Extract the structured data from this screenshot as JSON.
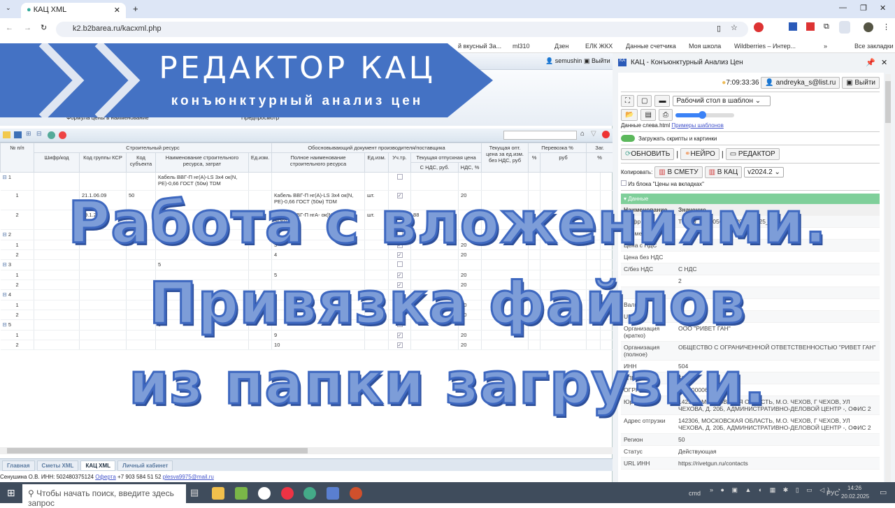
{
  "browser": {
    "tab_title": "КАЦ XML",
    "url": "k2.b2barea.ru/kacxml.php",
    "bookmarks": [
      "й вкусный За...",
      "ml310",
      "Дзен",
      "ЕЛК ЖКХ",
      "Данные счетчика",
      "Моя школа",
      "Wildberries – Интер...",
      "»",
      "Все закладки"
    ]
  },
  "banner": {
    "title": "РЕДАКТОР КАЦ",
    "subtitle": "конъюнктурный анализ цен"
  },
  "overlay": {
    "line1": "Работа с вложениями.",
    "line2": "Привязка файлов",
    "line3": "из папки загрузки."
  },
  "page": {
    "user": "semushin",
    "logout": "Выйти",
    "ribbon": [
      "Формула цены в наименование",
      "Предпросмотр"
    ],
    "headers": {
      "num": "№ п/п",
      "group1": "Строительный ресурс",
      "group2": "Обосновывающий документ производителя/поставщика",
      "opt": "Текущая опт. цена за ед.изм. без НДС, руб",
      "transport": "Перевозка %",
      "zag": "Заг.",
      "code": "Шифр/код",
      "ksr": "Код группы КСР",
      "subj": "Код субъекта",
      "name": "Наименование строительного ресурса, затрат",
      "unit": "Ед.изм.",
      "fullname": "Полное наименование строительного ресурса",
      "unit2": "Ед.изм.",
      "uch": "Уч.тр.",
      "price": "Текущая отпускная цена",
      "vat_price": "С НДС, руб.",
      "vat": "НДС, %",
      "pct": "%",
      "rub": "руб",
      "pct2": "%"
    },
    "rows": [
      {
        "n": "1",
        "g": true,
        "name": "Кабель ВВГ-П нг(А)-LS 3х4 ок(N, PE)-0,66 ГОСТ (50м) TDM",
        "chk": false
      },
      {
        "n": "1",
        "ksr": "21.1.06.09",
        "subj": "50",
        "full": "Кабель ВВГ-П нг(А)-LS 3х4 ок(N, PE)-0,66 ГОСТ (50м) TDM",
        "unit2": "шт.",
        "chk": true,
        "vat": "20"
      },
      {
        "n": "2",
        "ksr": "59.1.2",
        "subj": "77",
        "full": "Кабель ВВГ-П нгА- ок(N, PE) 50м SQ01 27",
        "unit2": "шт.",
        "chk": true,
        "vp": "88",
        "vat": ""
      },
      {
        "n": "2",
        "g": true,
        "chk": false
      },
      {
        "n": "1",
        "full": "3",
        "chk": true,
        "vat": "20"
      },
      {
        "n": "2",
        "full": "4",
        "chk": true,
        "vat": "20"
      },
      {
        "n": "3",
        "g": true,
        "name": "5",
        "chk": false
      },
      {
        "n": "1",
        "full": "5",
        "chk": true,
        "vat": "20"
      },
      {
        "n": "2",
        "chk": true,
        "vat": "20"
      },
      {
        "n": "4",
        "g": true,
        "name": "7",
        "chk": false
      },
      {
        "n": "1",
        "chk": true,
        "vat": "20"
      },
      {
        "n": "2",
        "chk": true,
        "vat": "20"
      },
      {
        "n": "5",
        "g": true,
        "name": "9",
        "chk": false
      },
      {
        "n": "1",
        "full": "9",
        "chk": true,
        "vat": "20"
      },
      {
        "n": "2",
        "full": "10",
        "chk": true,
        "vat": "20"
      }
    ],
    "bottom_tabs": [
      "Главная",
      "Сметы XML",
      "КАЦ XML",
      "Личный кабинет"
    ],
    "status": {
      "text": "Сенушина О.В. ИНН: 502480375124",
      "offer": "Оферта",
      "phone": "+7 903 584 51 52",
      "email": "plesva9975@mail.ru"
    }
  },
  "side": {
    "title": "КАЦ - Конъюнктурный Анализ Цен",
    "time": "7:09:33:36",
    "user": "andreyka_s@list.ru",
    "logout": "Выйти",
    "template_select": "Рабочий стол в шаблон",
    "data_file": "Данные слева.html",
    "examples": "Примеры шаблонов",
    "slider_value": 0.45,
    "load_toggle": "Загружать скрипты и картинки",
    "refresh": "ОБНОВИТЬ",
    "neuro": "НЕЙРО",
    "editor": "РЕДАКТОР",
    "copy_label": "Копировать:",
    "to_estimate": "В СМЕТУ",
    "to_kac": "В КАЦ",
    "version": "v2024.2",
    "from_block": "Из блока \"Цены на вкладках\"",
    "section": "▾ Данные",
    "col_name": "Наименование",
    "col_value": "Значение",
    "fields": [
      {
        "k": "Шифр",
        "v": "ТЦ_50_5048056632_20.02.2025_02"
      },
      {
        "k": "Наименование",
        "v": ""
      },
      {
        "k": "Цена с НДС",
        "v": ""
      },
      {
        "k": "Цена без НДС",
        "v": ""
      },
      {
        "k": "С/без НДС",
        "v": "С НДС"
      },
      {
        "k": "",
        "v": "2"
      },
      {
        "k": "",
        "v": "ш"
      },
      {
        "k": "Валюта",
        "v": ""
      },
      {
        "k": "URL",
        "v": ""
      },
      {
        "k": "Организация (кратко)",
        "v": "ООО \"РИВЕТ ГАН\""
      },
      {
        "k": "Организация (полное)",
        "v": "ОБЩЕСТВО С ОГРАНИЧЕННОЙ ОТВЕТСТВЕННОСТЬЮ \"РИВЕТ ГАН\""
      },
      {
        "k": "ИНН",
        "v": "504"
      },
      {
        "k": "КПП",
        "v": "504"
      },
      {
        "k": "ОГРН",
        "v": "1215000066709"
      },
      {
        "k": "Юр. адрес",
        "v": "142306, МОСКОВСКАЯ ОБЛАСТЬ, М.О. ЧЕХОВ, Г ЧЕХОВ, УЛ ЧЕХОВА, Д. 20Б, АДМИНИСТРАТИВНО-ДЕЛОВОЙ ЦЕНТР -, ОФИС 2"
      },
      {
        "k": "Адрес отгрузки",
        "v": "142306, МОСКОВСКАЯ ОБЛАСТЬ, М.О. ЧЕХОВ, Г ЧЕХОВ, УЛ ЧЕХОВА, Д. 20Б, АДМИНИСТРАТИВНО-ДЕЛОВОЙ ЦЕНТР -, ОФИС 2"
      },
      {
        "k": "Регион",
        "v": "50"
      },
      {
        "k": "Статус",
        "v": "Действующая"
      },
      {
        "k": "URL ИНН",
        "v": "https://rivetgun.ru/contacts"
      }
    ]
  },
  "taskbar": {
    "search_placeholder": "Чтобы начать поиск, введите здесь запрос",
    "cmd": "cmd",
    "lang": "РУС",
    "time": "14:26",
    "date": "20.02.2025"
  }
}
